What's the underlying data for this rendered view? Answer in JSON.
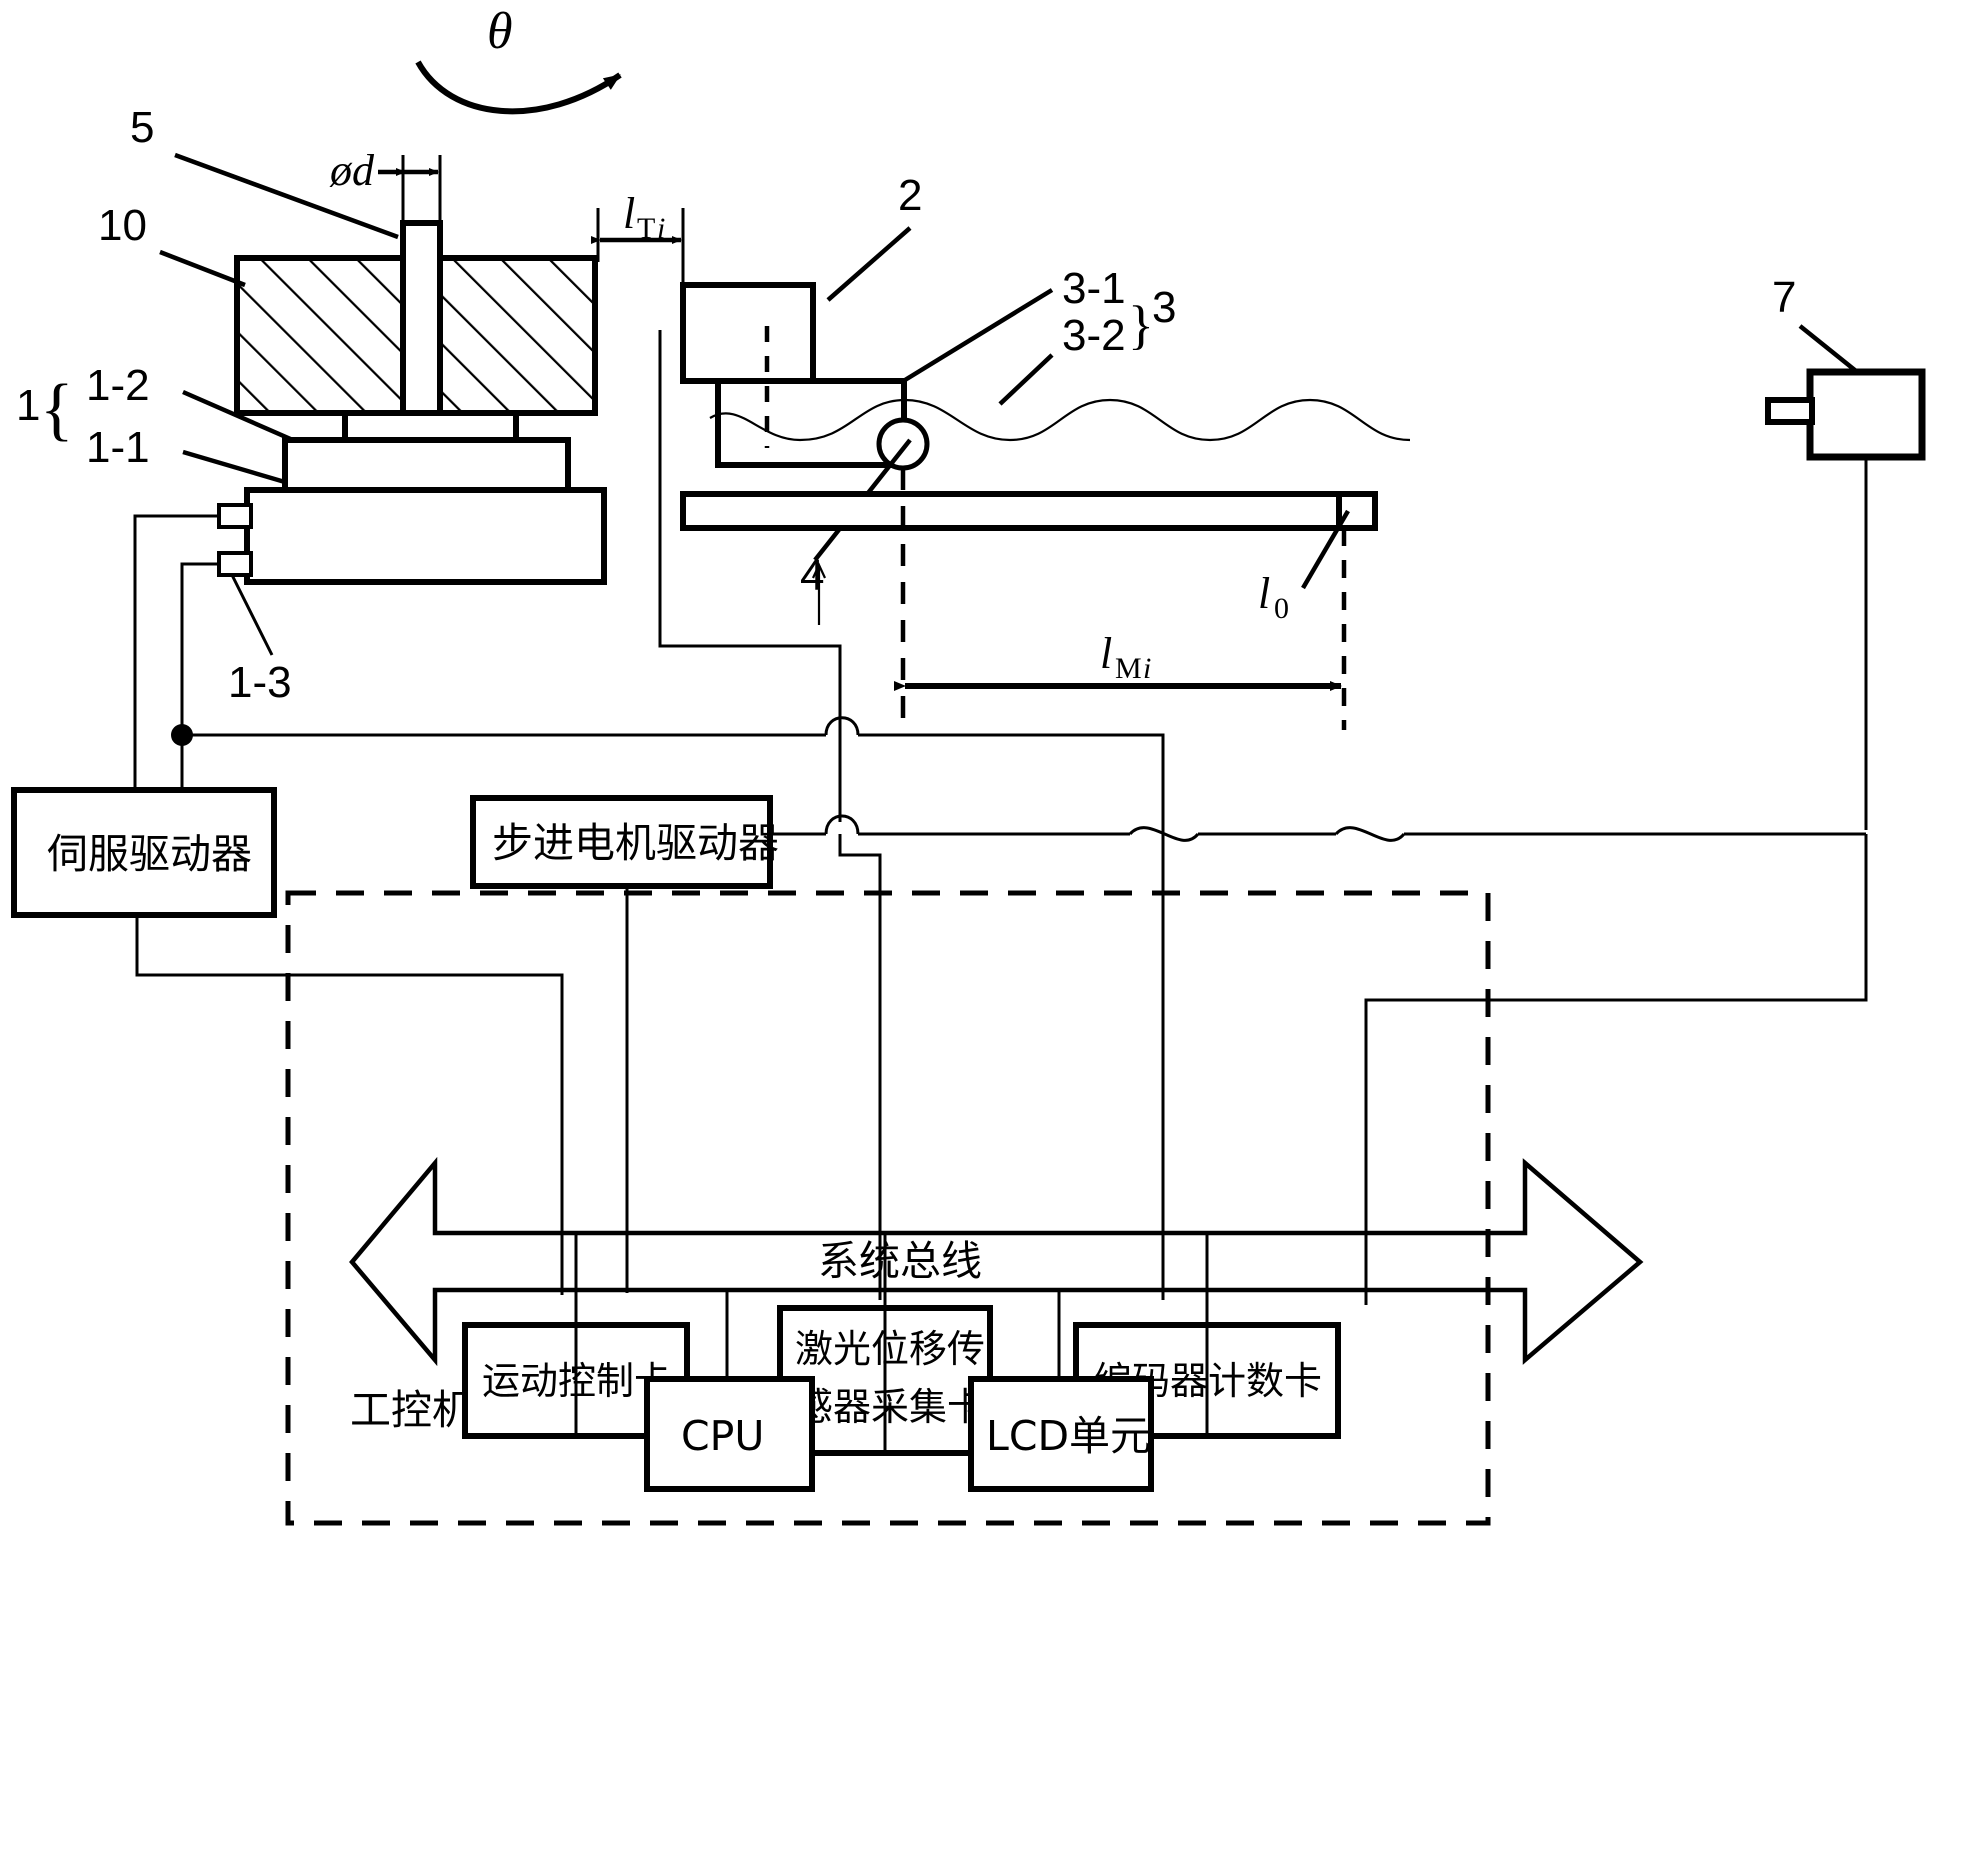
{
  "figure": {
    "type": "patent-schematic",
    "title_symbol": "θ",
    "reference_numbers": {
      "n1": "1",
      "n1_1": "1-1",
      "n1_2": "1-2",
      "n1_3": "1-3",
      "n2": "2",
      "n3": "3",
      "n3_1": "3-1",
      "n3_2": "3-2",
      "n4": "4",
      "n5": "5",
      "n7": "7",
      "n10": "10"
    },
    "dimensions": {
      "diameter": {
        "symbol": "ød",
        "text": "ød"
      },
      "l_Ti": {
        "base": "l",
        "sub": "T",
        "sub_italic": "i"
      },
      "l_Mi": {
        "base": "l",
        "sub": "M",
        "sub_italic": "i"
      },
      "l_0": {
        "base": "l",
        "sub": "0"
      }
    },
    "blocks": {
      "servo_driver": "伺服驱动器",
      "stepper_driver": "步进电机驱动器",
      "motion_control_card": "运动控制卡",
      "laser_sensor_card_line1": "激光位移传",
      "laser_sensor_card_line2": "感器采集卡",
      "encoder_counter_card": "编码器计数卡",
      "system_bus": "系统总线",
      "industrial_pc": "工控机",
      "cpu": "CPU",
      "lcd_unit": "LCD单元"
    },
    "colors": {
      "line": "#000000",
      "background": "#ffffff"
    }
  }
}
